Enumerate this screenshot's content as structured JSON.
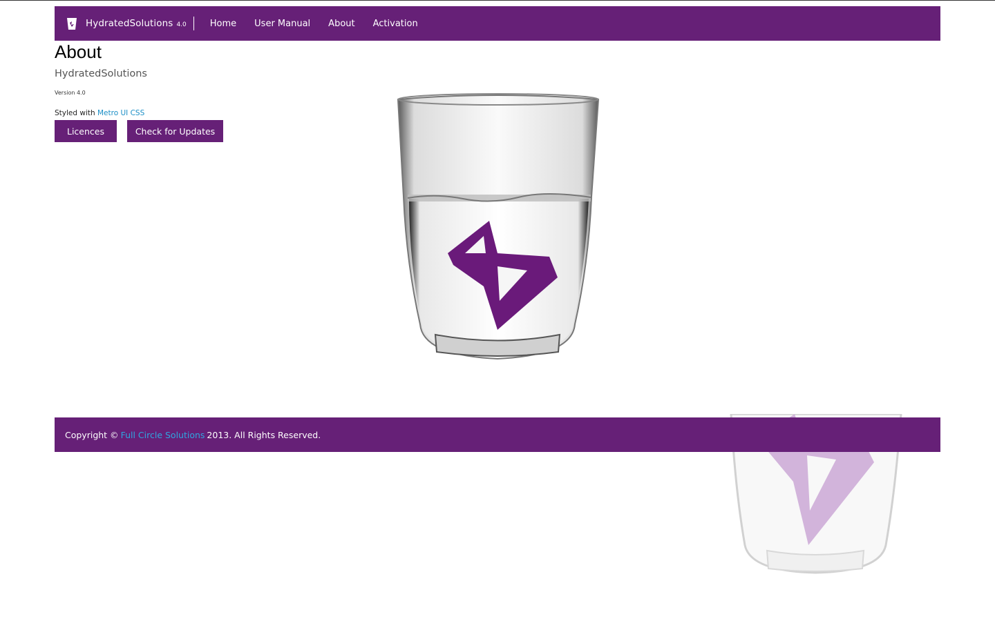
{
  "navbar": {
    "brand_name": "HydratedSolutions",
    "brand_version": "4.0",
    "brand_icon": "glass-logo-icon",
    "items": [
      {
        "label": "Home"
      },
      {
        "label": "User Manual"
      },
      {
        "label": "About"
      },
      {
        "label": "Activation"
      }
    ]
  },
  "main": {
    "title": "About",
    "app_name": "HydratedSolutions",
    "version": "Version 4.0",
    "styled_with_prefix": "Styled with",
    "styled_with_link": "Metro UI CSS",
    "buttons": {
      "licences": "Licences",
      "check_updates": "Check for Updates"
    }
  },
  "footer": {
    "copyright_prefix": "Copyright ©",
    "company_link": "Full Circle Solutions",
    "copyright_suffix": "2013. All Rights Reserved."
  },
  "colors": {
    "accent": "#662077",
    "link": "#1a8ec6",
    "footer_link": "#2fa6e0"
  }
}
